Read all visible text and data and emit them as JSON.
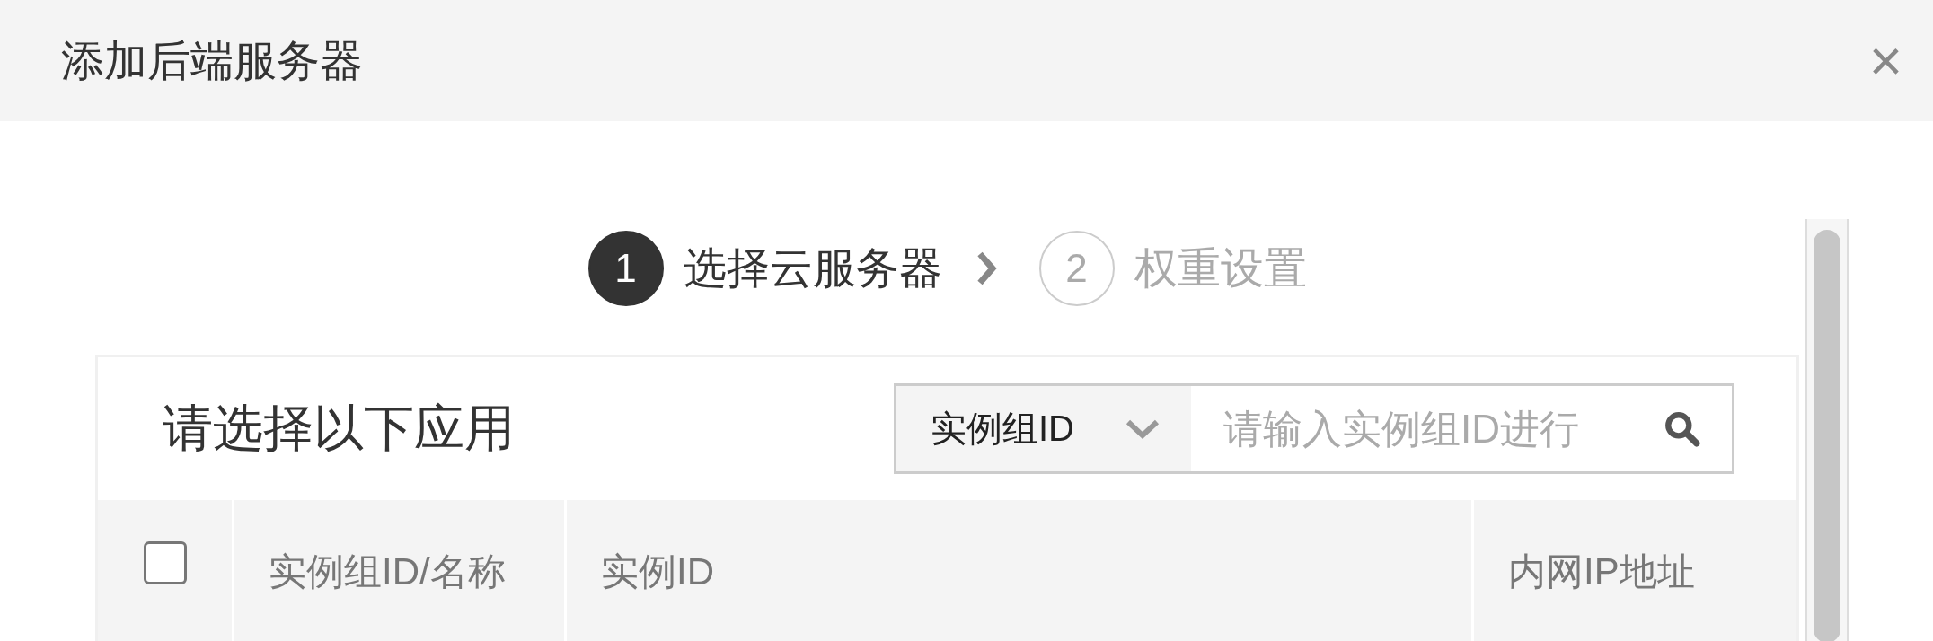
{
  "dialog": {
    "title": "添加后端服务器",
    "close": "×"
  },
  "steps": [
    {
      "number": "1",
      "label": "选择云服务器",
      "selected": true
    },
    {
      "number": "2",
      "label": "权重设置",
      "selected": false
    }
  ],
  "panel": {
    "title": "请选择以下应用",
    "search": {
      "filter": "实例组ID",
      "placeholder": "请输入实例组ID进行"
    },
    "table": {
      "select_all": {
        "checked": false
      },
      "columns": [
        "实例组ID/名称",
        "实例ID",
        "内网IP地址"
      ]
    }
  }
}
